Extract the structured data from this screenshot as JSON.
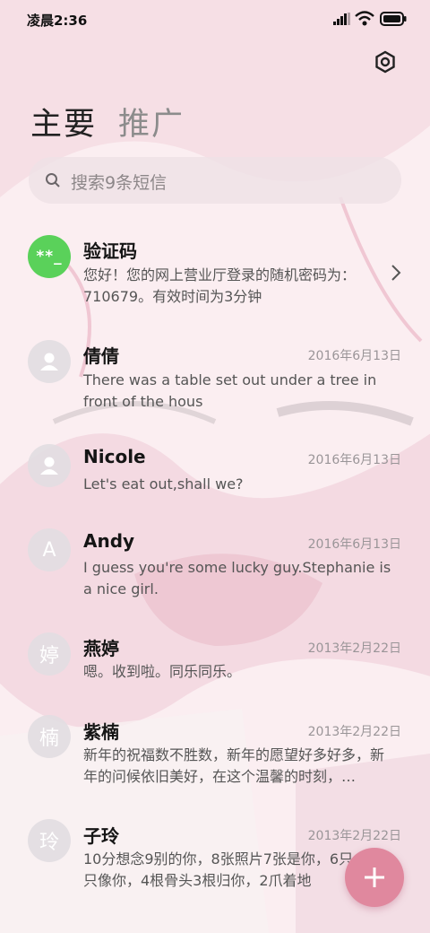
{
  "status_bar": {
    "time": "凌晨2:36"
  },
  "tabs": [
    {
      "label": "主要"
    },
    {
      "label": "推广"
    }
  ],
  "search": {
    "placeholder": "搜索9条短信"
  },
  "conversations": [
    {
      "name": "验证码",
      "avatar": "**_",
      "date": "",
      "preview": "您好！您的网上营业厅登录的随机密码为：710679。有效时间为3分钟"
    },
    {
      "name": "倩倩",
      "avatar": "",
      "date": "2016年6月13日",
      "preview": "There was a table set out under a tree in front of the hous"
    },
    {
      "name": "Nicole",
      "avatar": "",
      "date": "2016年6月13日",
      "preview": "Let's eat out,shall we?"
    },
    {
      "name": "Andy",
      "avatar": "A",
      "date": "2016年6月13日",
      "preview": "I guess you're some lucky guy.Stephanie is a nice girl."
    },
    {
      "name": "燕婷",
      "avatar": "婷",
      "date": "2013年2月22日",
      "preview": "嗯。收到啦。同乐同乐。"
    },
    {
      "name": "紫楠",
      "avatar": "楠",
      "date": "2013年2月22日",
      "preview": "新年的祝福数不胜数，新年的愿望好多好多，新年的问候依旧美好，在这个温馨的时刻，…"
    },
    {
      "name": "子玲",
      "avatar": "玲",
      "date": "2013年2月22日",
      "preview": "10分想念9别的你，8张照片7张是你，6只小狗5只像你，4根骨头3根归你，2爪着地"
    }
  ],
  "colors": {
    "accent_fab": "#e0889e",
    "code_avatar": "#5ad15a",
    "background": "#fbeef1"
  },
  "icons": [
    "settings-icon",
    "search-icon",
    "chevron-right-icon",
    "plus-icon",
    "person-icon"
  ]
}
